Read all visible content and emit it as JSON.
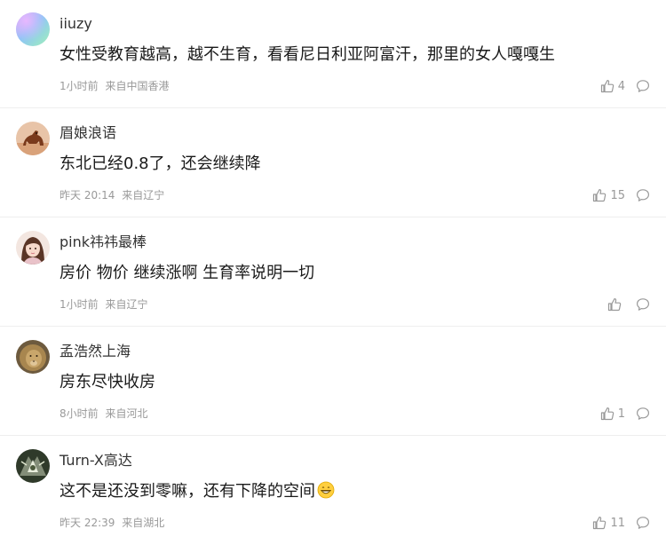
{
  "comments": [
    {
      "username": "iiuzy",
      "content": "女性受教育越高，越不生育，看看尼日利亚阿富汗，那里的女人嘎嘎生",
      "time": "1小时前",
      "location": "来自中国香港",
      "likes": "4",
      "avatar_icon": "gradient-avatar"
    },
    {
      "username": "眉娘浪语",
      "content": "东北已经0.8了，还会继续降",
      "time": "昨天 20:14",
      "location": "来自辽宁",
      "likes": "15",
      "avatar_icon": "horse-avatar"
    },
    {
      "username": "pink祎祎最棒",
      "content": "房价 物价 继续涨啊 生育率说明一切",
      "time": "1小时前",
      "location": "来自辽宁",
      "likes": "",
      "avatar_icon": "girl-avatar"
    },
    {
      "username": "孟浩然上海",
      "content": "房东尽快收房",
      "time": "8小时前",
      "location": "来自河北",
      "likes": "1",
      "avatar_icon": "lion-avatar"
    },
    {
      "username": "Turn-X高达",
      "content": "这不是还没到零嘛，还有下降的空间",
      "time": "昨天 22:39",
      "location": "来自湖北",
      "likes": "11",
      "avatar_icon": "robot-avatar",
      "emoji": "grinning-emoji"
    }
  ],
  "icons": {
    "like": "thumbs-up-icon",
    "reply": "comment-bubble-icon"
  },
  "colors": {
    "meta_text": "#999999",
    "divider": "#eeeeee"
  }
}
